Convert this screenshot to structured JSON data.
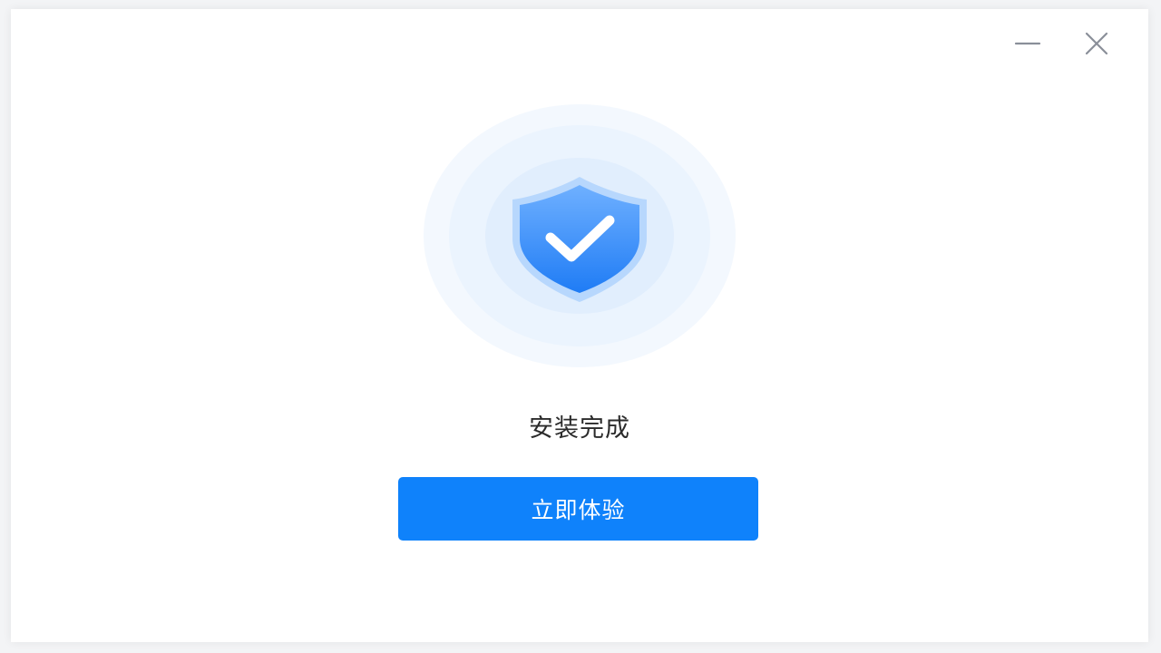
{
  "window": {
    "minimize_icon": "minimize-icon",
    "close_icon": "close-icon"
  },
  "hero": {
    "icon": "shield-check-icon"
  },
  "status": {
    "text": "安装完成"
  },
  "action": {
    "label": "立即体验"
  },
  "colors": {
    "accent": "#0f82fb",
    "text": "#2b2b2b",
    "window_controls": "#8a8f99",
    "halo": "#eaf3fe"
  }
}
